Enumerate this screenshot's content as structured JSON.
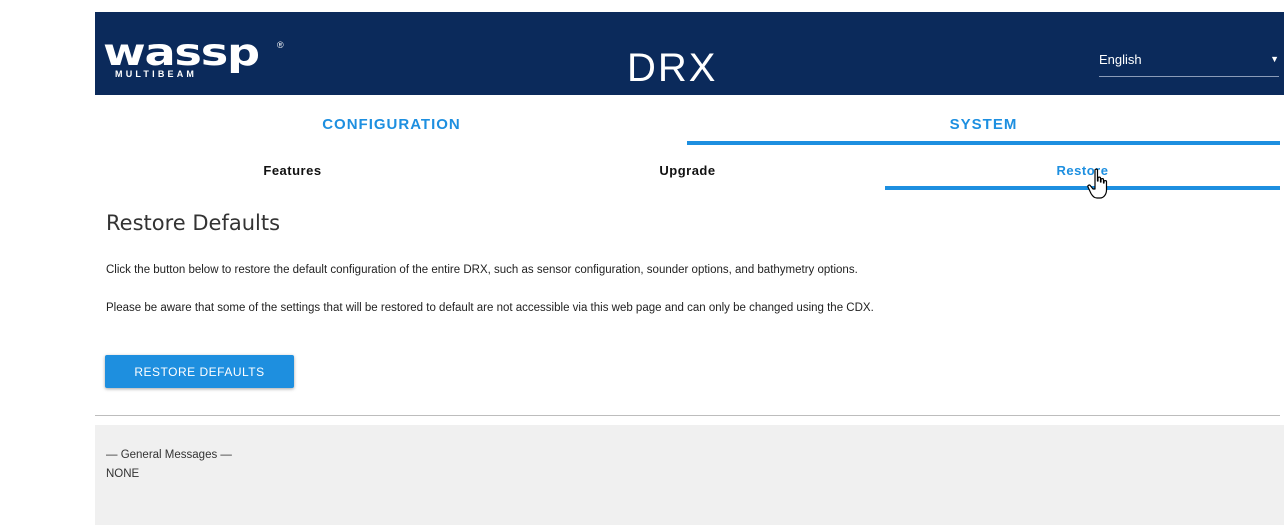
{
  "header": {
    "logo_text": "wassp",
    "logo_registered": "®",
    "logo_subtext": "MULTIBEAM",
    "product_title": "DRX",
    "language": {
      "selected": "English",
      "arrow_icon": "caret-down-icon"
    },
    "background_color": "#0b2a5b"
  },
  "tabs": {
    "main": [
      {
        "label": "CONFIGURATION",
        "active": false
      },
      {
        "label": "SYSTEM",
        "active": true
      }
    ],
    "sub": [
      {
        "label": "Features",
        "active": false
      },
      {
        "label": "Upgrade",
        "active": false
      },
      {
        "label": "Restore",
        "active": true
      }
    ],
    "accent_color": "#1d8fe0"
  },
  "main": {
    "title": "Restore Defaults",
    "paragraph1": "Click the button below to restore the default configuration of the entire DRX, such as sensor configuration, sounder options, and bathymetry options.",
    "paragraph2": "Please be aware that some of the settings that will be restored to default are not accessible via this web page and can only be changed using the CDX.",
    "restore_button_label": "RESTORE DEFAULTS"
  },
  "messages": {
    "heading": "— General Messages —",
    "body": "NONE"
  }
}
